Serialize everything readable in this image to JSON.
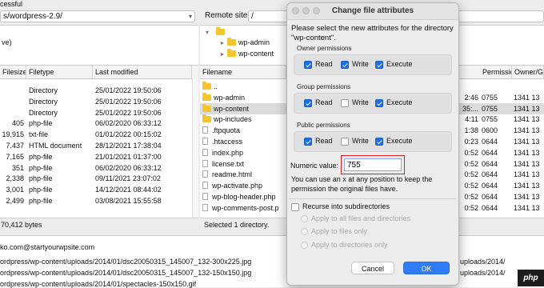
{
  "top_status": "cessful",
  "local": {
    "path": "s/wordpress-2.9/",
    "tree_item": "ve)",
    "columns": [
      "Filesize",
      "Filetype",
      "Last modified"
    ],
    "rows": [
      {
        "size": "",
        "type": "Directory",
        "modified": "25/01/2022 19:50:06"
      },
      {
        "size": "",
        "type": "Directory",
        "modified": "25/01/2022 19:50:06"
      },
      {
        "size": "",
        "type": "Directory",
        "modified": "25/01/2022 19:50:06"
      },
      {
        "size": "405",
        "type": "php-file",
        "modified": "06/02/2020 06:33:12"
      },
      {
        "size": "19,915",
        "type": "txt-file",
        "modified": "01/01/2022 00:15:02"
      },
      {
        "size": "7,437",
        "type": "HTML document",
        "modified": "28/12/2021 17:38:04"
      },
      {
        "size": "7,165",
        "type": "php-file",
        "modified": "21/01/2021 01:37:00"
      },
      {
        "size": "351",
        "type": "php-file",
        "modified": "06/02/2020 06:33:12"
      },
      {
        "size": "2,338",
        "type": "php-file",
        "modified": "09/11/2021 23:07:02"
      },
      {
        "size": "3,001",
        "type": "php-file",
        "modified": "14/12/2021 08:44:02"
      },
      {
        "size": "2,499",
        "type": "php-file",
        "modified": "03/08/2021 15:55:58"
      }
    ],
    "status": "70,412 bytes"
  },
  "remote": {
    "label": "Remote site:",
    "path": "/",
    "tree": [
      "wp-admin",
      "wp-content"
    ],
    "columns": [
      "Filename",
      "Permission",
      "Owner/G"
    ],
    "rows": [
      {
        "name": "..",
        "kind": "folder",
        "time": "",
        "perm": "",
        "owner": ""
      },
      {
        "name": "wp-admin",
        "kind": "folder",
        "time": "2:46",
        "perm": "0755",
        "owner": "1341 13"
      },
      {
        "name": "wp-content",
        "kind": "folder",
        "time": "35:...",
        "perm": "0755",
        "owner": "1341 13"
      },
      {
        "name": "wp-includes",
        "kind": "folder",
        "time": "4:11",
        "perm": "0755",
        "owner": "1341 13"
      },
      {
        "name": ".ftpquota",
        "kind": "file",
        "time": "1:38",
        "perm": "0600",
        "owner": "1341 13"
      },
      {
        "name": ".htaccess",
        "kind": "file",
        "time": "0:23",
        "perm": "0644",
        "owner": "1341 13"
      },
      {
        "name": "index.php",
        "kind": "file",
        "time": "0:52",
        "perm": "0644",
        "owner": "1341 13"
      },
      {
        "name": "license.txt",
        "kind": "file",
        "time": "0:52",
        "perm": "0644",
        "owner": "1341 13"
      },
      {
        "name": "readme.html",
        "kind": "file",
        "time": "0:52",
        "perm": "0644",
        "owner": "1341 13"
      },
      {
        "name": "wp-activate.php",
        "kind": "file",
        "time": "0:52",
        "perm": "0644",
        "owner": "1341 13"
      },
      {
        "name": "wp-blog-header.php",
        "kind": "file",
        "time": "0:52",
        "perm": "0644",
        "owner": "1341 13"
      },
      {
        "name": "wp-comments-post.p",
        "kind": "file",
        "time": "0:52",
        "perm": "0644",
        "owner": "1341 13"
      }
    ],
    "status": "Selected 1 directory."
  },
  "queue": {
    "lines": [
      "ko.com@startyourwpsite.com",
      "ordpress/wp-content/uploads/2014/01/dsc20050315_145007_132-300x225.jpg",
      "ordpress/wp-content/uploads/2014/01/dsc20050315_145007_132-150x150.jpg",
      "ordpress/wp-content/uploads/2014/01/spectacles-150x150.gif"
    ],
    "right_lines": [
      "",
      "uploads/2014/",
      "uploads/2014/",
      ""
    ],
    "arrow": "<--"
  },
  "dialog": {
    "title": "Change file attributes",
    "intro": "Please select the new attributes for the directory \"wp-content\".",
    "groups": [
      {
        "label": "Owner permissions",
        "read": true,
        "write": true,
        "execute": true
      },
      {
        "label": "Group permissions",
        "read": true,
        "write": false,
        "execute": true
      },
      {
        "label": "Public permissions",
        "read": true,
        "write": false,
        "execute": true
      }
    ],
    "read_label": "Read",
    "write_label": "Write",
    "execute_label": "Execute",
    "numeric_label": "Numeric value:",
    "numeric_value": "755",
    "hint": "You can use an x at any position to keep the permission the original files have.",
    "recurse_label": "Recurse into subdirectories",
    "radio_all": "Apply to all files and directories",
    "radio_files": "Apply to files only",
    "radio_dirs": "Apply to directories only",
    "cancel_label": "Cancel",
    "ok_label": "OK",
    "highlight_color": "#d0232a",
    "accent_color": "#2f7cf6"
  },
  "watermark": "php"
}
